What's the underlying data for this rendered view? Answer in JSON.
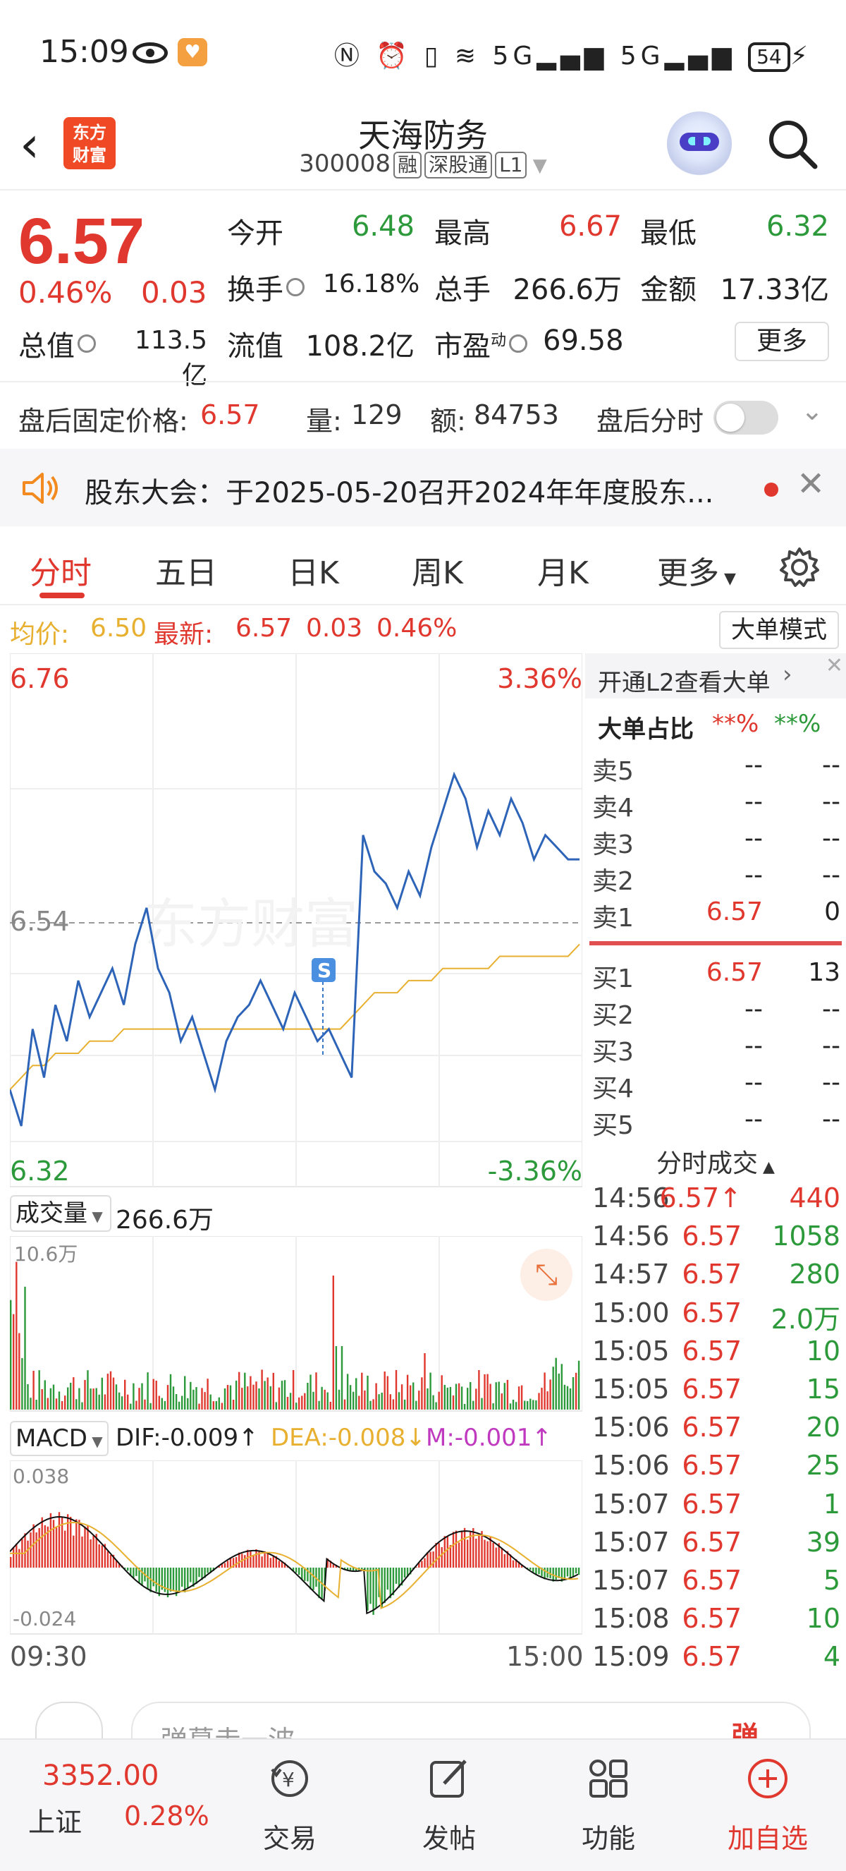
{
  "status_bar": {
    "time": "15:09",
    "battery": "54"
  },
  "header": {
    "title": "天海防务",
    "code": "300008",
    "tags": [
      "融",
      "深股通",
      "L1"
    ],
    "logo_text": "东方财富"
  },
  "quote": {
    "price": "6.57",
    "change_pct": "0.46%",
    "change": "0.03",
    "open_label": "今开",
    "open": "6.48",
    "high_label": "最高",
    "high": "6.67",
    "low_label": "最低",
    "low": "6.32",
    "turnover_label": "换手",
    "turnover": "16.18%",
    "volume_label": "总手",
    "volume": "266.6万",
    "amount_label": "金额",
    "amount": "17.33亿",
    "mktcap_label": "总值",
    "mktcap": "113.5亿",
    "float_label": "流值",
    "float": "108.2亿",
    "pe_label": "市盈",
    "pe_sup": "动",
    "pe": "69.58",
    "more": "更多"
  },
  "after_hours": {
    "price_label": "盘后固定价格:",
    "price": "6.57",
    "vol_label": "量:",
    "vol": "129",
    "amt_label": "额:",
    "amt": "84753",
    "toggle_label": "盘后分时"
  },
  "notice": {
    "text": "股东大会：于2025-05-20召开2024年年度股东..."
  },
  "tabs": [
    "分时",
    "五日",
    "日K",
    "周K",
    "月K",
    "更多"
  ],
  "avg_line": {
    "avg_label": "均价:",
    "avg": "6.50",
    "latest_label": "最新:",
    "latest": "6.57",
    "chg": "0.03",
    "pct": "0.46%",
    "mode_btn": "大单模式"
  },
  "chart_labels": {
    "price_high": "6.76",
    "pct_high": "3.36%",
    "price_mid": "6.54",
    "price_low": "6.32",
    "pct_low": "-3.36%",
    "watermark": "东方财富",
    "signal": "S",
    "vol_label": "成交量",
    "vol_total": "266.6万",
    "vol_max": "10.6万",
    "macd_label": "MACD",
    "dif": "DIF:-0.009",
    "dea": "DEA:-0.008",
    "m": "M:-0.001",
    "macd_top": "0.038",
    "macd_bottom": "-0.024",
    "time_start": "09:30",
    "time_end": "15:00"
  },
  "chart_data": {
    "type": "line",
    "price_range": [
      6.32,
      6.76
    ],
    "prev_close": 6.54,
    "price_series": [
      6.4,
      6.37,
      6.45,
      6.41,
      6.47,
      6.44,
      6.49,
      6.46,
      6.48,
      6.5,
      6.47,
      6.52,
      6.55,
      6.5,
      6.48,
      6.44,
      6.46,
      6.43,
      6.4,
      6.44,
      6.46,
      6.47,
      6.49,
      6.47,
      6.45,
      6.48,
      6.46,
      6.44,
      6.45,
      6.43,
      6.41,
      6.61,
      6.58,
      6.57,
      6.55,
      6.58,
      6.56,
      6.6,
      6.63,
      6.66,
      6.64,
      6.6,
      6.63,
      6.61,
      6.64,
      6.62,
      6.59,
      6.61,
      6.6,
      6.59,
      6.59
    ],
    "avg_series": [
      6.4,
      6.41,
      6.42,
      6.42,
      6.43,
      6.43,
      6.43,
      6.44,
      6.44,
      6.44,
      6.45,
      6.45,
      6.45,
      6.45,
      6.45,
      6.45,
      6.45,
      6.45,
      6.45,
      6.45,
      6.45,
      6.45,
      6.45,
      6.45,
      6.45,
      6.45,
      6.45,
      6.45,
      6.45,
      6.45,
      6.46,
      6.47,
      6.48,
      6.48,
      6.48,
      6.49,
      6.49,
      6.49,
      6.5,
      6.5,
      6.5,
      6.5,
      6.5,
      6.51,
      6.51,
      6.51,
      6.51,
      6.51,
      6.51,
      6.51,
      6.52
    ],
    "volume_max": "10.6万",
    "macd_range": [
      -0.024,
      0.038
    ]
  },
  "order_book": {
    "l2_label": "开通L2查看大单",
    "big_label": "大单占比",
    "big_a": "**%",
    "big_b": "**%",
    "sells": [
      {
        "label": "卖5",
        "price": "--",
        "vol": "--"
      },
      {
        "label": "卖4",
        "price": "--",
        "vol": "--"
      },
      {
        "label": "卖3",
        "price": "--",
        "vol": "--"
      },
      {
        "label": "卖2",
        "price": "--",
        "vol": "--"
      },
      {
        "label": "卖1",
        "price": "6.57",
        "vol": "0"
      }
    ],
    "buys": [
      {
        "label": "买1",
        "price": "6.57",
        "vol": "13"
      },
      {
        "label": "买2",
        "price": "--",
        "vol": "--"
      },
      {
        "label": "买3",
        "price": "--",
        "vol": "--"
      },
      {
        "label": "买4",
        "price": "--",
        "vol": "--"
      },
      {
        "label": "买5",
        "price": "--",
        "vol": "--"
      }
    ],
    "ticks_label": "分时成交",
    "ticks": [
      {
        "time": "14:56",
        "price": "6.57↑",
        "vol": "440",
        "color": "red"
      },
      {
        "time": "14:56",
        "price": "6.57",
        "vol": "1058",
        "color": "green"
      },
      {
        "time": "14:57",
        "price": "6.57",
        "vol": "280",
        "color": "green"
      },
      {
        "time": "15:00",
        "price": "6.57",
        "vol": "2.0万",
        "color": "green"
      },
      {
        "time": "15:05",
        "price": "6.57",
        "vol": "10",
        "color": "green"
      },
      {
        "time": "15:05",
        "price": "6.57",
        "vol": "15",
        "color": "green"
      },
      {
        "time": "15:06",
        "price": "6.57",
        "vol": "20",
        "color": "green"
      },
      {
        "time": "15:06",
        "price": "6.57",
        "vol": "25",
        "color": "green"
      },
      {
        "time": "15:07",
        "price": "6.57",
        "vol": "1",
        "color": "green"
      },
      {
        "time": "15:07",
        "price": "6.57",
        "vol": "39",
        "color": "green"
      },
      {
        "time": "15:07",
        "price": "6.57",
        "vol": "5",
        "color": "green"
      },
      {
        "time": "15:08",
        "price": "6.57",
        "vol": "10",
        "color": "green"
      },
      {
        "time": "15:09",
        "price": "6.57",
        "vol": "4",
        "color": "green"
      }
    ]
  },
  "comment": {
    "placeholder": "弹幕走一波",
    "btn": "弹"
  },
  "bottom_nav": {
    "index_value": "3352.00",
    "index_name": "上证",
    "index_pct": "0.28%",
    "items": [
      "交易",
      "发帖",
      "功能",
      "加自选"
    ]
  }
}
